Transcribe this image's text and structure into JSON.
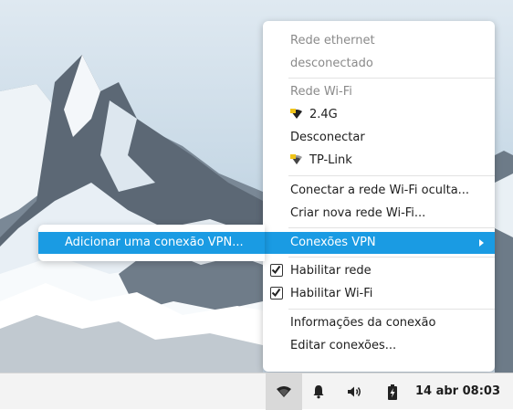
{
  "menu": {
    "ethernet": {
      "header": "Rede ethernet",
      "status": "desconectado"
    },
    "wifi": {
      "header": "Rede Wi-Fi",
      "networks": [
        {
          "name": "2.4G",
          "icon": "wifi-secure-icon"
        },
        {
          "name": "TP-Link",
          "icon": "wifi-secure-icon"
        }
      ],
      "disconnect": "Desconectar"
    },
    "actions": {
      "hidden_network": "Conectar a rede Wi-Fi oculta...",
      "new_network": "Criar nova rede Wi-Fi..."
    },
    "vpn": {
      "label": "Conexões VPN",
      "submenu": {
        "add_vpn": "Adicionar uma conexão VPN..."
      }
    },
    "toggles": {
      "enable_network": {
        "label": "Habilitar rede",
        "checked": true
      },
      "enable_wifi": {
        "label": "Habilitar Wi-Fi",
        "checked": true
      }
    },
    "info": {
      "connection_info": "Informações da conexão",
      "edit_connections": "Editar conexões..."
    }
  },
  "taskbar": {
    "icons": [
      "network-wifi-icon",
      "bell-icon",
      "volume-icon",
      "battery-charging-icon"
    ],
    "clock": "14 abr 08:03"
  },
  "colors": {
    "highlight": "#1a9be3",
    "header_text": "#8a8a8a"
  }
}
